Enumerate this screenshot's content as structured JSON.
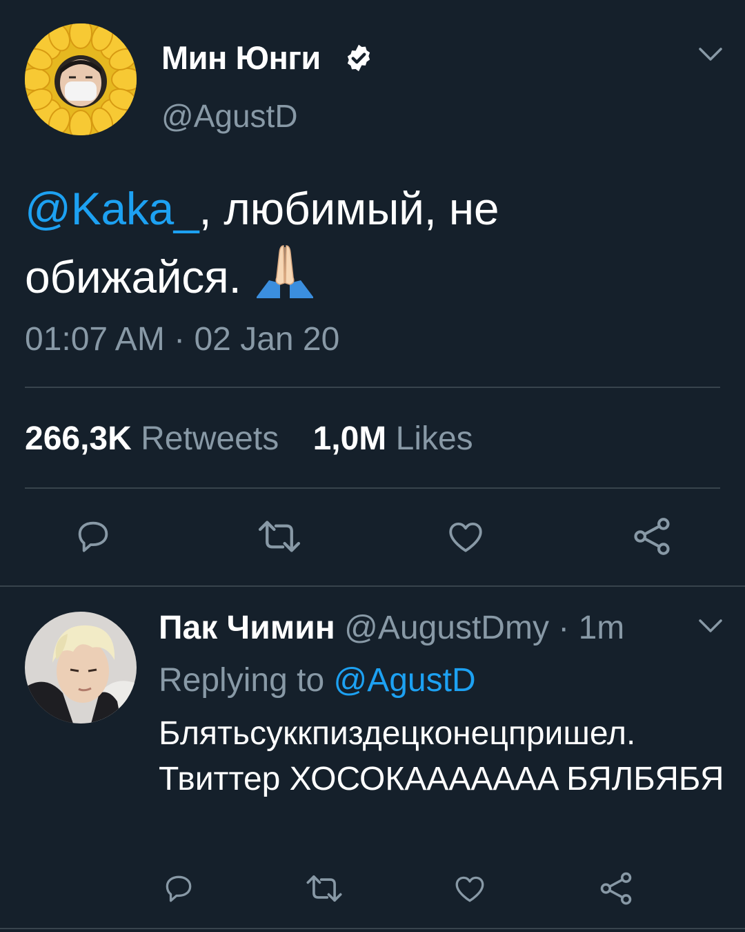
{
  "main_tweet": {
    "author_name": "Мин Юнги",
    "verified_icon": "verified-badge-icon",
    "handle": "@AgustD",
    "mention": "@Kaka_",
    "text_after_mention": ", любимый, не обижайся.",
    "emoji": "folded-hands-emoji",
    "timestamp": "01:07 AM · 02 Jan 20",
    "stats": {
      "retweets_count": "266,3K",
      "retweets_label": "Retweets",
      "likes_count": "1,0M",
      "likes_label": "Likes"
    },
    "actions": [
      "reply-icon",
      "retweet-icon",
      "like-icon",
      "share-icon"
    ]
  },
  "reply_tweet": {
    "author_name": "Пак Чимин",
    "handle_time": "@AugustDmy · 1m",
    "replying_prefix": "Replying to",
    "replying_to": "@AgustD",
    "text": "Блятьсуккпиздецконецпришел. Твиттер ХОСОКАААААAA БЯЛБЯБЯ",
    "actions": [
      "reply-icon",
      "retweet-icon",
      "like-icon",
      "share-icon"
    ]
  },
  "colors": {
    "background": "#15202b",
    "accent": "#1da1f2",
    "secondary_text": "#8899a6",
    "divider": "#38444d"
  }
}
